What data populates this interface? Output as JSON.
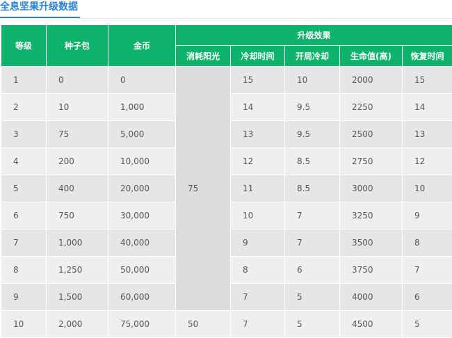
{
  "title": "全息坚果升级数据",
  "headers": {
    "level": "等级",
    "seed_pack": "种子包",
    "coins": "金币",
    "upgrade_effect": "升级效果",
    "sun_cost": "消耗阳光",
    "cooldown": "冷却时间",
    "start_cooldown": "开局冷却",
    "health": "生命值(高)",
    "recovery_time": "恢复时间"
  },
  "sun_cost_merged": "75",
  "rows": [
    {
      "level": "1",
      "seed_pack": "0",
      "coins": "0",
      "cooldown": "15",
      "start_cooldown": "10",
      "health": "2000",
      "recovery_time": "15"
    },
    {
      "level": "2",
      "seed_pack": "10",
      "coins": "1,000",
      "cooldown": "14",
      "start_cooldown": "9.5",
      "health": "2250",
      "recovery_time": "14"
    },
    {
      "level": "3",
      "seed_pack": "75",
      "coins": "5,000",
      "cooldown": "13",
      "start_cooldown": "9.5",
      "health": "2500",
      "recovery_time": "13"
    },
    {
      "level": "4",
      "seed_pack": "200",
      "coins": "10,000",
      "cooldown": "12",
      "start_cooldown": "8.5",
      "health": "2750",
      "recovery_time": "12"
    },
    {
      "level": "5",
      "seed_pack": "400",
      "coins": "20,000",
      "cooldown": "11",
      "start_cooldown": "8.5",
      "health": "3000",
      "recovery_time": "10"
    },
    {
      "level": "6",
      "seed_pack": "750",
      "coins": "30,000",
      "cooldown": "10",
      "start_cooldown": "7",
      "health": "3250",
      "recovery_time": "9"
    },
    {
      "level": "7",
      "seed_pack": "1,000",
      "coins": "40,000",
      "cooldown": "9",
      "start_cooldown": "7",
      "health": "3500",
      "recovery_time": "8"
    },
    {
      "level": "8",
      "seed_pack": "1,250",
      "coins": "50,000",
      "cooldown": "8",
      "start_cooldown": "6",
      "health": "3750",
      "recovery_time": "7"
    },
    {
      "level": "9",
      "seed_pack": "1,500",
      "coins": "60,000",
      "cooldown": "7",
      "start_cooldown": "5",
      "health": "4000",
      "recovery_time": "6"
    },
    {
      "level": "10",
      "seed_pack": "2,000",
      "coins": "75,000",
      "sun_cost": "50",
      "cooldown": "7",
      "start_cooldown": "5",
      "health": "4500",
      "recovery_time": "5"
    }
  ],
  "colors": {
    "header_green": "#0db36a",
    "title_blue": "#2a82d0",
    "row_dark": "#e6e6e6",
    "row_light": "#efefef"
  }
}
